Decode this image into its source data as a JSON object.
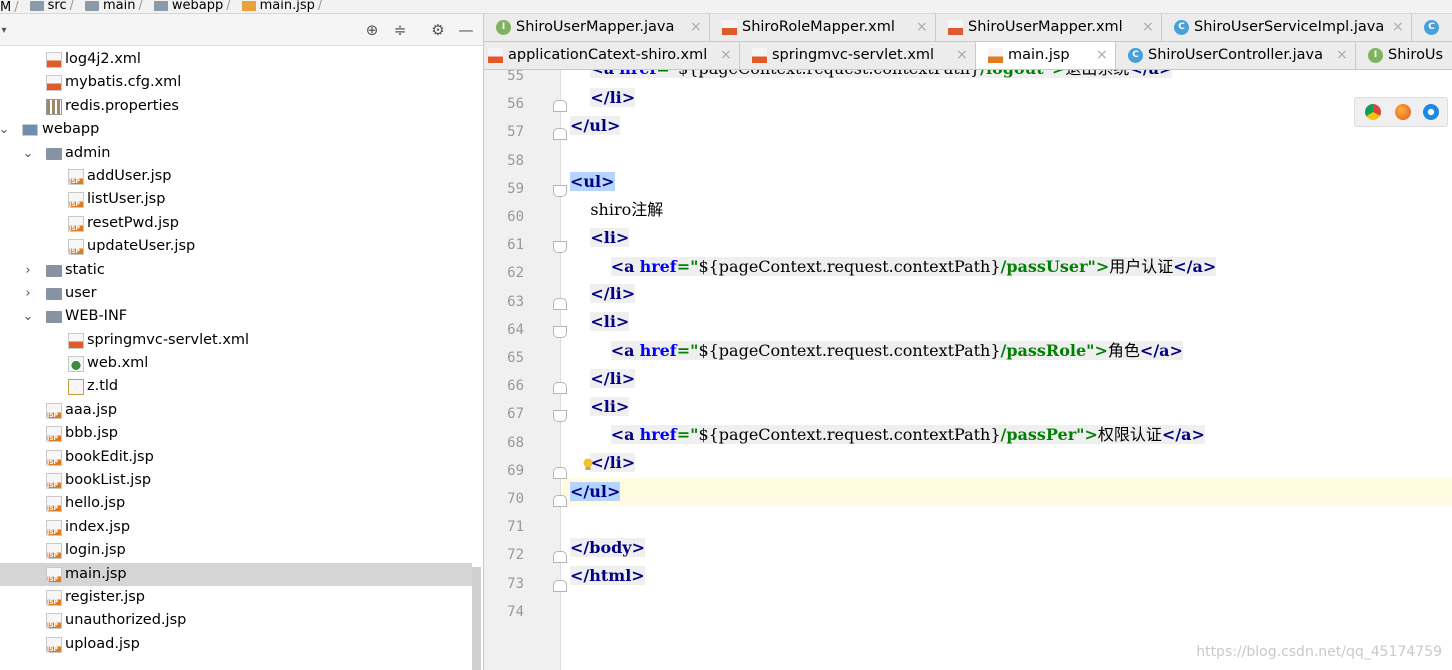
{
  "breadcrumb": [
    {
      "label": "M",
      "icon": "module-icon"
    },
    {
      "label": "src",
      "icon": "folder-icon"
    },
    {
      "label": "main",
      "icon": "folder-icon"
    },
    {
      "label": "webapp",
      "icon": "folder-icon"
    },
    {
      "label": "main.jsp",
      "icon": "jsp-file-icon"
    }
  ],
  "project": {
    "tree": [
      {
        "label": "log4j2.xml",
        "icon": "xml-file-icon",
        "depth": 2
      },
      {
        "label": "mybatis.cfg.xml",
        "icon": "xml-file-icon",
        "depth": 2
      },
      {
        "label": "redis.properties",
        "icon": "properties-file-icon",
        "depth": 2
      },
      {
        "label": "webapp",
        "icon": "web-folder-icon",
        "depth": 0,
        "expanded": true
      },
      {
        "label": "admin",
        "icon": "folder-icon",
        "depth": 1,
        "expanded": true
      },
      {
        "label": "addUser.jsp",
        "icon": "jsp-file-icon",
        "depth": 3
      },
      {
        "label": "listUser.jsp",
        "icon": "jsp-file-icon",
        "depth": 3
      },
      {
        "label": "resetPwd.jsp",
        "icon": "jsp-file-icon",
        "depth": 3
      },
      {
        "label": "updateUser.jsp",
        "icon": "jsp-file-icon",
        "depth": 3
      },
      {
        "label": "static",
        "icon": "folder-icon",
        "depth": 1,
        "expanded": false
      },
      {
        "label": "user",
        "icon": "folder-icon",
        "depth": 1,
        "expanded": false
      },
      {
        "label": "WEB-INF",
        "icon": "folder-icon",
        "depth": 1,
        "expanded": true
      },
      {
        "label": "springmvc-servlet.xml",
        "icon": "spring-xml-file-icon",
        "depth": 3
      },
      {
        "label": "web.xml",
        "icon": "web-xml-file-icon",
        "depth": 3
      },
      {
        "label": "z.tld",
        "icon": "tld-file-icon",
        "depth": 3
      },
      {
        "label": "aaa.jsp",
        "icon": "jsp-file-icon",
        "depth": 2
      },
      {
        "label": "bbb.jsp",
        "icon": "jsp-file-icon",
        "depth": 2
      },
      {
        "label": "bookEdit.jsp",
        "icon": "jsp-file-icon",
        "depth": 2
      },
      {
        "label": "bookList.jsp",
        "icon": "jsp-file-icon",
        "depth": 2
      },
      {
        "label": "hello.jsp",
        "icon": "jsp-file-icon",
        "depth": 2
      },
      {
        "label": "index.jsp",
        "icon": "jsp-file-icon",
        "depth": 2
      },
      {
        "label": "login.jsp",
        "icon": "jsp-file-icon",
        "depth": 2
      },
      {
        "label": "main.jsp",
        "icon": "jsp-file-icon",
        "depth": 2,
        "selected": true
      },
      {
        "label": "register.jsp",
        "icon": "jsp-file-icon",
        "depth": 2
      },
      {
        "label": "unauthorized.jsp",
        "icon": "jsp-file-icon",
        "depth": 2
      },
      {
        "label": "upload.jsp",
        "icon": "jsp-file-icon",
        "depth": 2
      }
    ]
  },
  "tabs": {
    "row1": [
      {
        "label": "ShiroUserMapper.java",
        "kind": "I"
      },
      {
        "label": "ShiroRoleMapper.xml",
        "kind": "X"
      },
      {
        "label": "ShiroUserMapper.xml",
        "kind": "X"
      },
      {
        "label": "ShiroUserServiceImpl.java",
        "kind": "C"
      },
      {
        "label": "",
        "kind": "C"
      }
    ],
    "row2": [
      {
        "label": "applicationCatext-shiro.xml",
        "kind": "X"
      },
      {
        "label": "springmvc-servlet.xml",
        "kind": "X"
      },
      {
        "label": "main.jsp",
        "kind": "J",
        "active": true
      },
      {
        "label": "ShiroUserController.java",
        "kind": "C"
      },
      {
        "label": "ShiroUs",
        "kind": "I"
      }
    ],
    "close_glyph": "×"
  },
  "editor": {
    "line_numbers": [
      "55",
      "56",
      "57",
      "58",
      "59",
      "60",
      "61",
      "62",
      "63",
      "64",
      "65",
      "66",
      "67",
      "68",
      "69",
      "70",
      "71",
      "72",
      "73",
      "74"
    ],
    "current_line": "70",
    "partial_top": {
      "a": "a",
      "href": "href",
      "q1": "=\"",
      "expr": "${pageContext.request.contextPath}",
      "path": "/logout",
      "q2": "\">",
      "text": "退出系统",
      "close": "</a>"
    },
    "lines": {
      "l56": "</li>",
      "l57": "</ul>",
      "l59": "<ul>",
      "l60": "shiro注解",
      "l61": "<li>",
      "l62_text": "用户认证",
      "l62_path": "/passUser",
      "l63": "</li>",
      "l64": "<li>",
      "l65_text": "角色",
      "l65_path": "/passRole",
      "l66": "</li>",
      "l67": "<li>",
      "l68_text": "权限认证",
      "l68_path": "/passPer",
      "l69": "</li>",
      "l70": "</ul>",
      "l72": "</body>",
      "l73": "</html>"
    },
    "link_open": "<a",
    "href_attr": "href",
    "eq_quote": "=\"",
    "expr": "${pageContext.request.contextPath}",
    "close_quote": "\">",
    "link_close": "</a>"
  },
  "watermark": "https://blog.csdn.net/qq_45174759",
  "colors": {
    "tag": "#000080",
    "attr": "#0000ff",
    "string": "#008000",
    "selection": "#b5d5ff",
    "current_line": "#fffbe0"
  }
}
